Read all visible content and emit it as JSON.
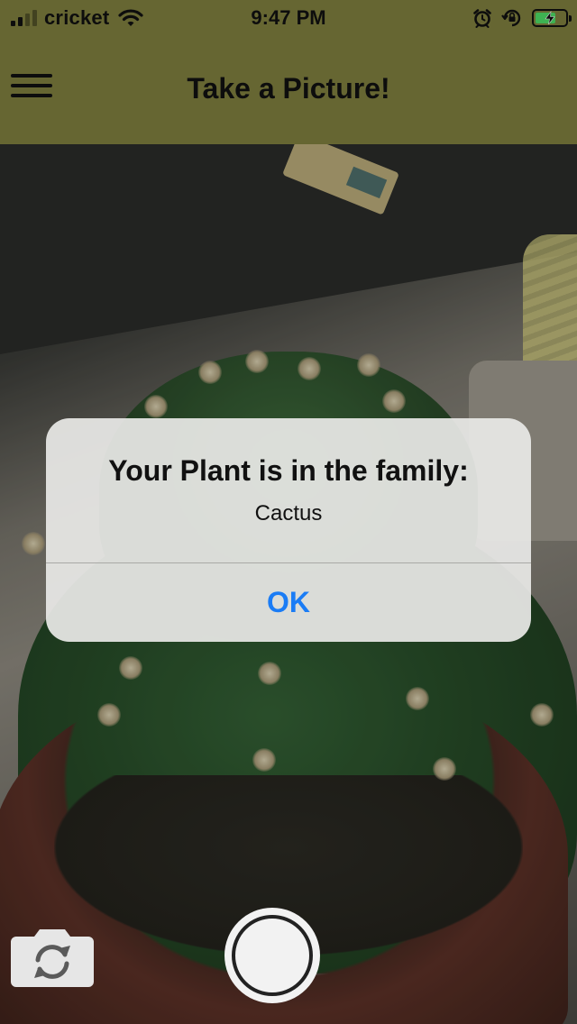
{
  "status_bar": {
    "carrier": "cricket",
    "time": "9:47 PM",
    "signal_bars_total": 4,
    "signal_bars_filled": 2,
    "battery_level": 0.7,
    "charging": true,
    "icons": [
      "signal-icon",
      "wifi-icon",
      "alarm-icon",
      "rotation-lock-icon",
      "battery-icon"
    ]
  },
  "nav": {
    "title": "Take a Picture!",
    "menu_icon": "hamburger-menu-icon"
  },
  "alert": {
    "title": "Your Plant is in the family:",
    "message": "Cactus",
    "button_label": "OK"
  },
  "camera_controls": {
    "switch_icon": "switch-camera-icon",
    "shutter_icon": "shutter-button"
  },
  "colors": {
    "header": "#7d7d3e",
    "alert_button": "#1a7cf5",
    "battery_fill": "#4cd964"
  }
}
